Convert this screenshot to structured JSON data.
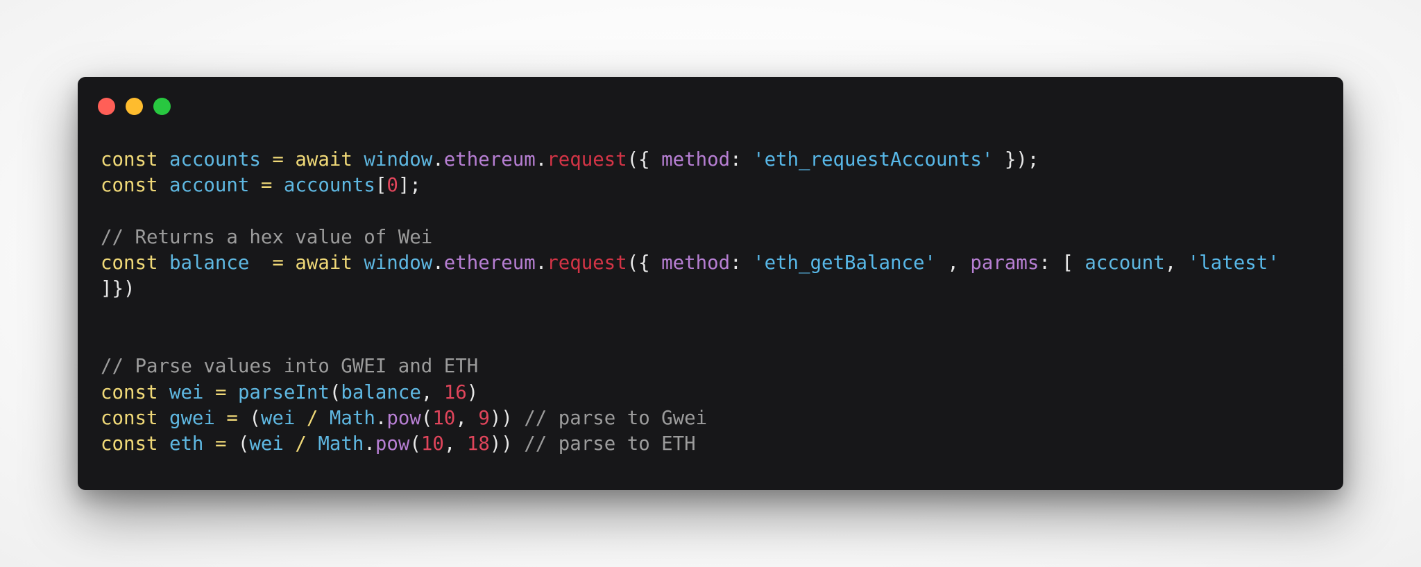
{
  "window": {
    "controls": [
      "close",
      "minimize",
      "maximize"
    ]
  },
  "code_lines": [
    [
      {
        "t": "const",
        "c": "kw"
      },
      {
        "t": " ",
        "c": "pl"
      },
      {
        "t": "accounts",
        "c": "vr"
      },
      {
        "t": " ",
        "c": "pl"
      },
      {
        "t": "=",
        "c": "op"
      },
      {
        "t": " ",
        "c": "pl"
      },
      {
        "t": "await",
        "c": "kw"
      },
      {
        "t": " ",
        "c": "pl"
      },
      {
        "t": "window",
        "c": "vr"
      },
      {
        "t": ".",
        "c": "pl"
      },
      {
        "t": "ethereum",
        "c": "pr"
      },
      {
        "t": ".",
        "c": "pl"
      },
      {
        "t": "request",
        "c": "fn"
      },
      {
        "t": "({ ",
        "c": "pl"
      },
      {
        "t": "method",
        "c": "pr"
      },
      {
        "t": ": ",
        "c": "pl"
      },
      {
        "t": "'eth_requestAccounts'",
        "c": "st"
      },
      {
        "t": " });",
        "c": "pl"
      }
    ],
    [
      {
        "t": "const",
        "c": "kw"
      },
      {
        "t": " ",
        "c": "pl"
      },
      {
        "t": "account",
        "c": "vr"
      },
      {
        "t": " ",
        "c": "pl"
      },
      {
        "t": "=",
        "c": "op"
      },
      {
        "t": " ",
        "c": "pl"
      },
      {
        "t": "accounts",
        "c": "vr"
      },
      {
        "t": "[",
        "c": "pl"
      },
      {
        "t": "0",
        "c": "nm"
      },
      {
        "t": "];",
        "c": "pl"
      }
    ],
    [],
    [
      {
        "t": "// Returns a hex value of Wei",
        "c": "cm"
      }
    ],
    [
      {
        "t": "const",
        "c": "kw"
      },
      {
        "t": " ",
        "c": "pl"
      },
      {
        "t": "balance",
        "c": "vr"
      },
      {
        "t": "  ",
        "c": "pl"
      },
      {
        "t": "=",
        "c": "op"
      },
      {
        "t": " ",
        "c": "pl"
      },
      {
        "t": "await",
        "c": "kw"
      },
      {
        "t": " ",
        "c": "pl"
      },
      {
        "t": "window",
        "c": "vr"
      },
      {
        "t": ".",
        "c": "pl"
      },
      {
        "t": "ethereum",
        "c": "pr"
      },
      {
        "t": ".",
        "c": "pl"
      },
      {
        "t": "request",
        "c": "fn"
      },
      {
        "t": "({ ",
        "c": "pl"
      },
      {
        "t": "method",
        "c": "pr"
      },
      {
        "t": ": ",
        "c": "pl"
      },
      {
        "t": "'eth_getBalance'",
        "c": "st"
      },
      {
        "t": " , ",
        "c": "pl"
      },
      {
        "t": "params",
        "c": "pr"
      },
      {
        "t": ": [ ",
        "c": "pl"
      },
      {
        "t": "account",
        "c": "vr"
      },
      {
        "t": ", ",
        "c": "pl"
      },
      {
        "t": "'latest'",
        "c": "st"
      }
    ],
    [
      {
        "t": "]})",
        "c": "pl"
      }
    ],
    [],
    [],
    [
      {
        "t": "// Parse values into GWEI and ETH",
        "c": "cm"
      }
    ],
    [
      {
        "t": "const",
        "c": "kw"
      },
      {
        "t": " ",
        "c": "pl"
      },
      {
        "t": "wei",
        "c": "vr"
      },
      {
        "t": " ",
        "c": "pl"
      },
      {
        "t": "=",
        "c": "op"
      },
      {
        "t": " ",
        "c": "pl"
      },
      {
        "t": "parseInt",
        "c": "vr"
      },
      {
        "t": "(",
        "c": "pl"
      },
      {
        "t": "balance",
        "c": "vr"
      },
      {
        "t": ", ",
        "c": "pl"
      },
      {
        "t": "16",
        "c": "nm"
      },
      {
        "t": ")",
        "c": "pl"
      }
    ],
    [
      {
        "t": "const",
        "c": "kw"
      },
      {
        "t": " ",
        "c": "pl"
      },
      {
        "t": "gwei",
        "c": "vr"
      },
      {
        "t": " ",
        "c": "pl"
      },
      {
        "t": "=",
        "c": "op"
      },
      {
        "t": " (",
        "c": "pl"
      },
      {
        "t": "wei",
        "c": "vr"
      },
      {
        "t": " ",
        "c": "pl"
      },
      {
        "t": "/",
        "c": "op"
      },
      {
        "t": " ",
        "c": "pl"
      },
      {
        "t": "Math",
        "c": "vr"
      },
      {
        "t": ".",
        "c": "pl"
      },
      {
        "t": "pow",
        "c": "pr"
      },
      {
        "t": "(",
        "c": "pl"
      },
      {
        "t": "10",
        "c": "nm"
      },
      {
        "t": ", ",
        "c": "pl"
      },
      {
        "t": "9",
        "c": "nm"
      },
      {
        "t": ")) ",
        "c": "pl"
      },
      {
        "t": "// parse to Gwei",
        "c": "cm"
      }
    ],
    [
      {
        "t": "const",
        "c": "kw"
      },
      {
        "t": " ",
        "c": "pl"
      },
      {
        "t": "eth",
        "c": "vr"
      },
      {
        "t": " ",
        "c": "pl"
      },
      {
        "t": "=",
        "c": "op"
      },
      {
        "t": " (",
        "c": "pl"
      },
      {
        "t": "wei",
        "c": "vr"
      },
      {
        "t": " ",
        "c": "pl"
      },
      {
        "t": "/",
        "c": "op"
      },
      {
        "t": " ",
        "c": "pl"
      },
      {
        "t": "Math",
        "c": "vr"
      },
      {
        "t": ".",
        "c": "pl"
      },
      {
        "t": "pow",
        "c": "pr"
      },
      {
        "t": "(",
        "c": "pl"
      },
      {
        "t": "10",
        "c": "nm"
      },
      {
        "t": ", ",
        "c": "pl"
      },
      {
        "t": "18",
        "c": "nm"
      },
      {
        "t": ")) ",
        "c": "pl"
      },
      {
        "t": "// parse to ETH",
        "c": "cm"
      }
    ]
  ]
}
